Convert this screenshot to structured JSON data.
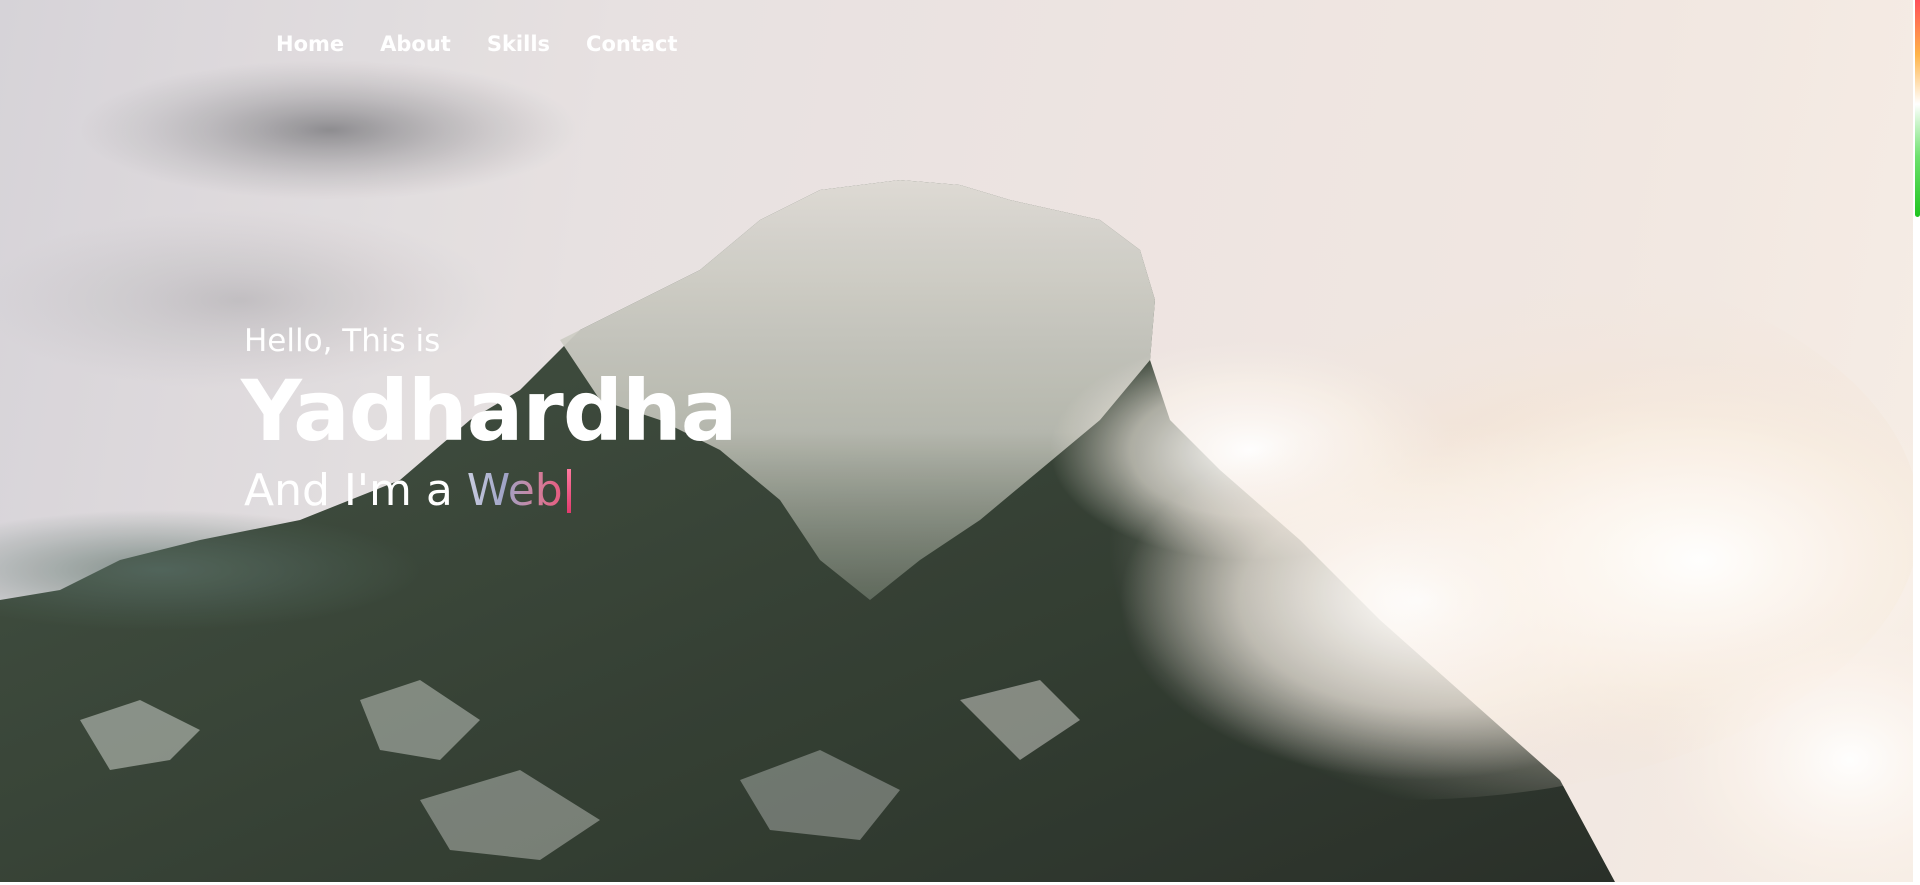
{
  "nav": {
    "links": [
      {
        "label": "Home"
      },
      {
        "label": "About"
      },
      {
        "label": "Skills"
      },
      {
        "label": "Contact"
      }
    ]
  },
  "hero": {
    "greeting": "Hello, This is",
    "name": "Yadhardha",
    "tagline_static": "And I'm a ",
    "tagline_typed": "Web"
  },
  "scroll_progress": {
    "percent": 24.5,
    "colors": [
      "#ff4f5a",
      "#ffb347",
      "#ffffff",
      "#6fe26f",
      "#1fc41f"
    ]
  },
  "background": {
    "icon": "mountain-landscape-image"
  }
}
